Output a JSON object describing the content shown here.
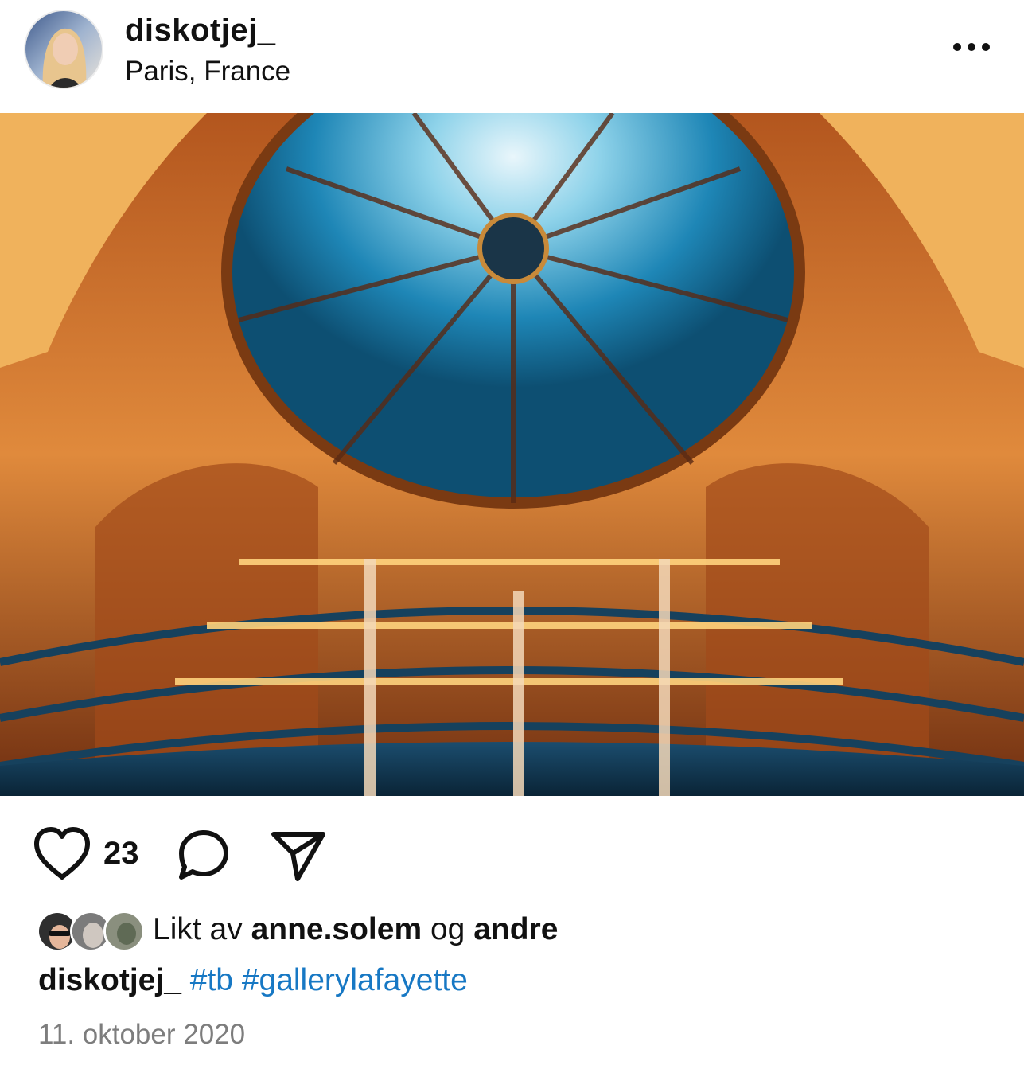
{
  "post": {
    "username": "diskotjej_",
    "location": "Paris, France",
    "like_count": "23",
    "liked_by_prefix": "Likt av",
    "liked_by_user": "anne.solem",
    "liked_by_joiner": "og",
    "liked_by_others": "andre",
    "caption_user": "diskotjej_",
    "hashtags": [
      "#tb",
      "#gallerylafayette"
    ],
    "date": "11. oktober 2020"
  },
  "icons": {
    "more": "more-options-icon",
    "like": "heart-icon",
    "comment": "comment-bubble-icon",
    "share": "paper-plane-icon"
  },
  "colors": {
    "hashtag": "#1778c4",
    "date": "#7d7d7d",
    "text": "#111111"
  }
}
